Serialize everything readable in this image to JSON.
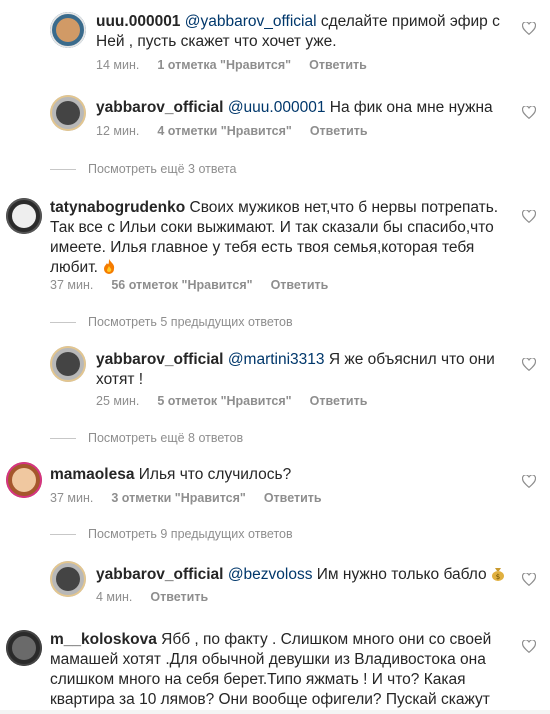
{
  "comments": [
    {
      "username": "uuu.000001",
      "mention": "@yabbarov_official",
      "lines": [
        " сделайте примой эфир с",
        "Ней , пусть скажет что хочет уже."
      ],
      "time": "14 мин.",
      "likes": "1 отметка \"Нравится\"",
      "reply": "Ответить"
    },
    {
      "username": "yabbarov_official",
      "mention": "@uuu.000001",
      "lines": [
        " На фик она мне нужна"
      ],
      "time": "12 мин.",
      "likes": "4 отметки \"Нравится\"",
      "reply": "Ответить"
    },
    {
      "view_more": "Посмотреть ещё 3 ответа"
    },
    {
      "username": "tatynabogrudenko",
      "lines": [
        " Своих мужиков нет,что б нервы потрепать.",
        "Так все с Ильи соки выжимают. И так сказали бы спасибо,что",
        "имеете. Илья главное у тебя есть твоя семья,которая тебя",
        "любит."
      ],
      "emoji": "fire",
      "time": "37 мин.",
      "likes": "56 отметок \"Нравится\"",
      "reply": "Ответить"
    },
    {
      "view_prev": "Посмотреть 5 предыдущих ответов"
    },
    {
      "username": "yabbarov_official",
      "mention": "@martini3313",
      "lines": [
        " Я же объяснил что они",
        "хотят !"
      ],
      "time": "25 мин.",
      "likes": "5 отметок \"Нравится\"",
      "reply": "Ответить"
    },
    {
      "view_more": "Посмотреть ещё 8 ответов"
    },
    {
      "username": "mamaolesa",
      "lines": [
        " Илья что случилось?"
      ],
      "time": "37 мин.",
      "likes": "3 отметки \"Нравится\"",
      "reply": "Ответить"
    },
    {
      "view_prev": "Посмотреть 9 предыдущих ответов"
    },
    {
      "username": "yabbarov_official",
      "mention": "@bezvoloss",
      "lines": [
        " Им нужно только бабло"
      ],
      "emoji": "money-bag",
      "time": "4 мин.",
      "reply": "Ответить"
    },
    {
      "username": "m__koloskova",
      "lines": [
        " Ябб , по факту . Слишком много они со своей",
        "мамашей хотят .Для обычной девушки из Владивостока она",
        "слишком много на себя берет.Типо яжмать ! И что? Какая",
        "квартира за 10 лямов? Они вообще офигели? Пускай скажут"
      ]
    }
  ],
  "colors": {
    "text": "#262626",
    "meta": "#8e8e8e",
    "mention": "#00376b"
  },
  "icons": [
    "heart-icon",
    "fire-emoji",
    "money-bag-emoji"
  ]
}
